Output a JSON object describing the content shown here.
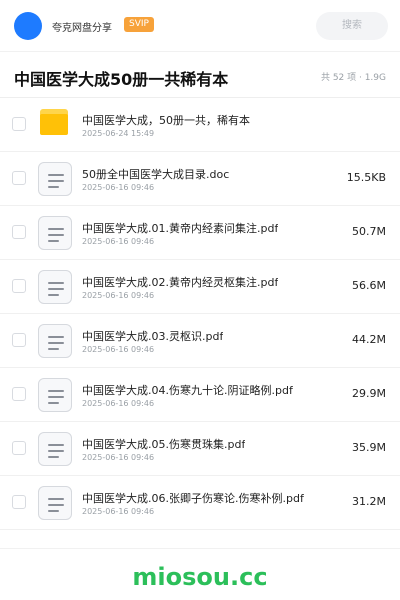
{
  "header": {
    "user_name": "夸克网盘分享",
    "badge": "SVIP",
    "search_placeholder": "搜索"
  },
  "folder": {
    "title": "中国医学大成50册一共稀有本",
    "stats": "共 52 项 · 1.9G"
  },
  "files": [
    {
      "type": "folder",
      "name": "中国医学大成，50册一共，稀有本",
      "date": "2025-06-24 15:49",
      "size": ""
    },
    {
      "type": "doc",
      "name": "50册全中国医学大成目录.doc",
      "date": "2025-06-16 09:46",
      "size": "15.5KB"
    },
    {
      "type": "doc",
      "name": "中国医学大成.01.黄帝内经素问集注.pdf",
      "date": "2025-06-16 09:46",
      "size": "50.7M"
    },
    {
      "type": "doc",
      "name": "中国医学大成.02.黄帝内经灵枢集注.pdf",
      "date": "2025-06-16 09:46",
      "size": "56.6M"
    },
    {
      "type": "doc",
      "name": "中国医学大成.03.灵枢识.pdf",
      "date": "2025-06-16 09:46",
      "size": "44.2M"
    },
    {
      "type": "doc",
      "name": "中国医学大成.04.伤寒九十论.阴证略例.pdf",
      "date": "2025-06-16 09:46",
      "size": "29.9M"
    },
    {
      "type": "doc",
      "name": "中国医学大成.05.伤寒贯珠集.pdf",
      "date": "2025-06-16 09:46",
      "size": "35.9M"
    },
    {
      "type": "doc",
      "name": "中国医学大成.06.张卿子伤寒论.伤寒补例.pdf",
      "date": "2025-06-16 09:46",
      "size": "31.2M"
    }
  ],
  "footer": {
    "brand": "miosou.cc"
  },
  "colors": {
    "avatar": "#1e7bff",
    "badge": "#f7a23a",
    "folder_icon": "#ffc107",
    "brand": "#2cbf5a"
  }
}
